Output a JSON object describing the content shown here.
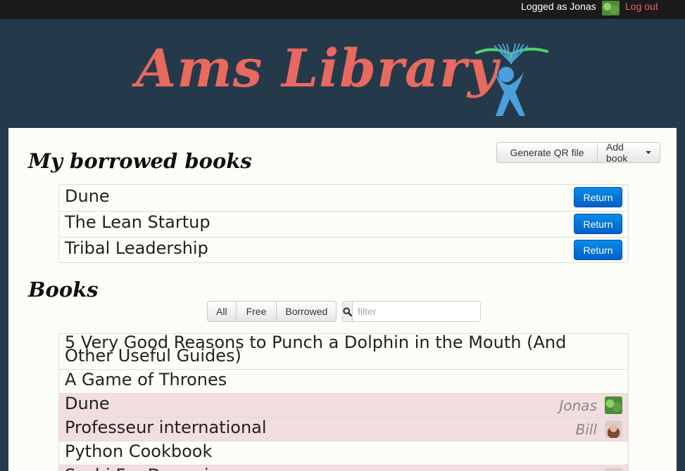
{
  "topbar": {
    "logged_text": "Logged as Jonas",
    "logout_label": "Log out"
  },
  "header": {
    "logo_text": "Ams Library",
    "logo_icon": "reader-book-icon",
    "colors": {
      "logo_text": "#e8695f",
      "logo_figure": "#4a9fdc",
      "logo_book": "#4fd46a",
      "header_bg": "#243a4a"
    }
  },
  "toolbar": {
    "generate_qr_label": "Generate QR file",
    "add_book_label": "Add book"
  },
  "borrowed_section": {
    "title": "My borrowed books",
    "items": [
      {
        "title": "Dune",
        "action": "Return"
      },
      {
        "title": "The Lean Startup",
        "action": "Return"
      },
      {
        "title": "Tribal Leadership",
        "action": "Return"
      }
    ]
  },
  "books_section": {
    "title": "Books",
    "filters": [
      "All",
      "Free",
      "Borrowed"
    ],
    "search": {
      "placeholder": "filter",
      "value": ""
    },
    "items": [
      {
        "title_line1": "5 Very Good Reasons to Punch a Dolphin in the Mouth (And",
        "title_line2": "Other Useful Guides)",
        "borrowed": false
      },
      {
        "title": "A Game of Thrones",
        "borrowed": false
      },
      {
        "title": "Dune",
        "borrowed": true,
        "borrower": "Jonas"
      },
      {
        "title": "Professeur international",
        "borrowed": true,
        "borrower": "Bill"
      },
      {
        "title": "Python Cookbook",
        "borrowed": false
      },
      {
        "title": "Sushi For Dummies",
        "borrowed": true
      }
    ],
    "colors": {
      "borrowed_row": "#f2dede",
      "return_button": "#0470d8"
    }
  }
}
